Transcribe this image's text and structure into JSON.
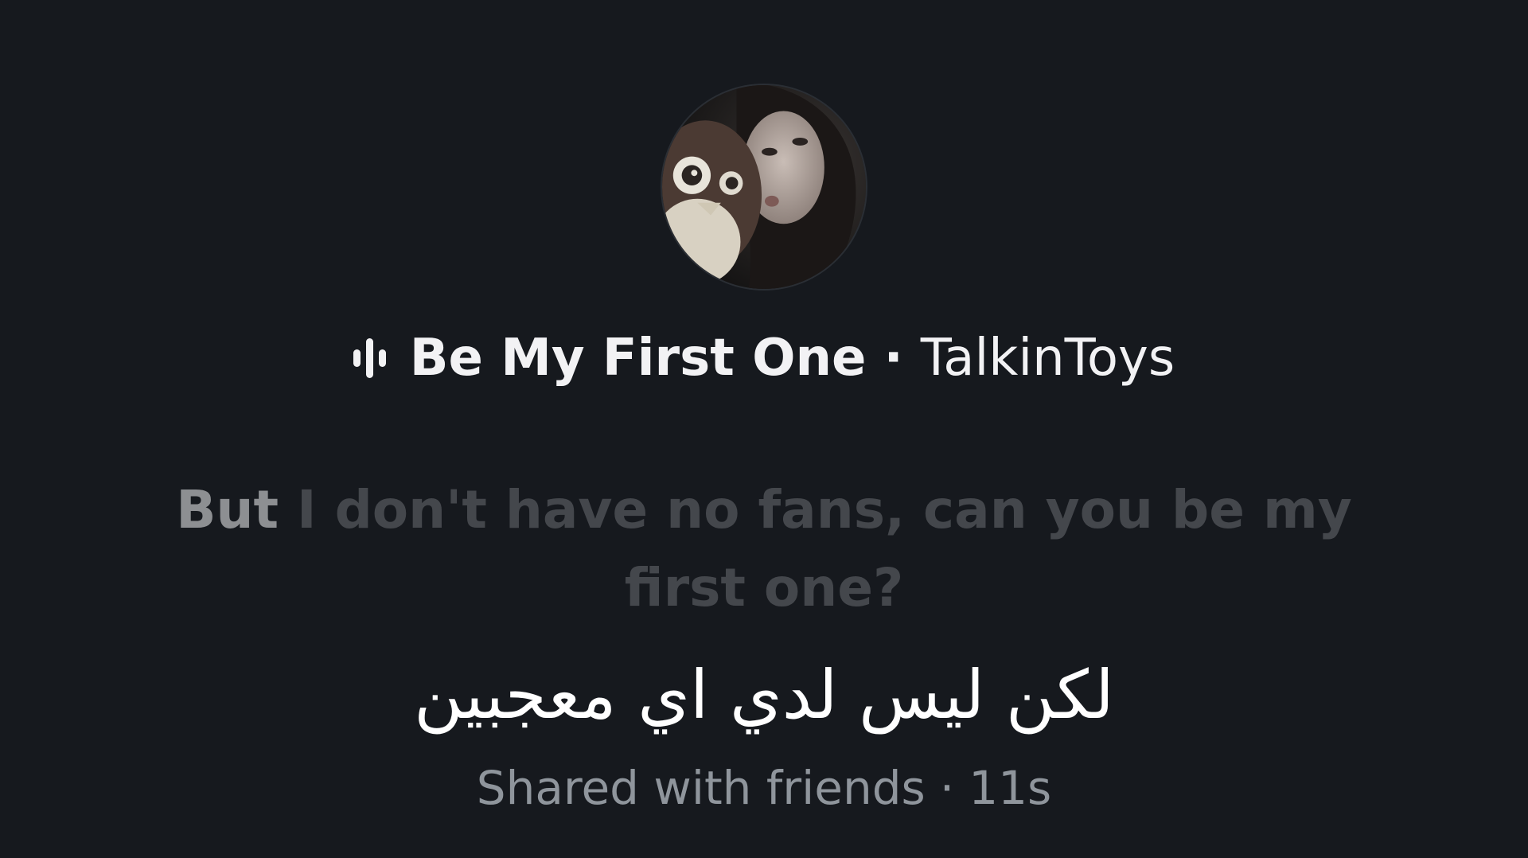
{
  "song": {
    "title": "Be My First One",
    "separator": "·",
    "artist": "TalkinToys"
  },
  "lyric": {
    "active_part": "But",
    "rest": "I don't have no fans, can you be my first one?"
  },
  "translation": {
    "text": "لكن ليس لدي اي معجبين"
  },
  "footer": {
    "audience": "Shared with friends",
    "separator": "·",
    "time_ago": "11s"
  },
  "icons": {
    "audio": "waveform-icon",
    "profile": "avatar"
  },
  "colors": {
    "background": "#16191e",
    "primary_text": "#f2f2f4",
    "lyric_dim": "#44474c",
    "lyric_active": "#8d8f92",
    "footer_text": "#8f959c"
  }
}
